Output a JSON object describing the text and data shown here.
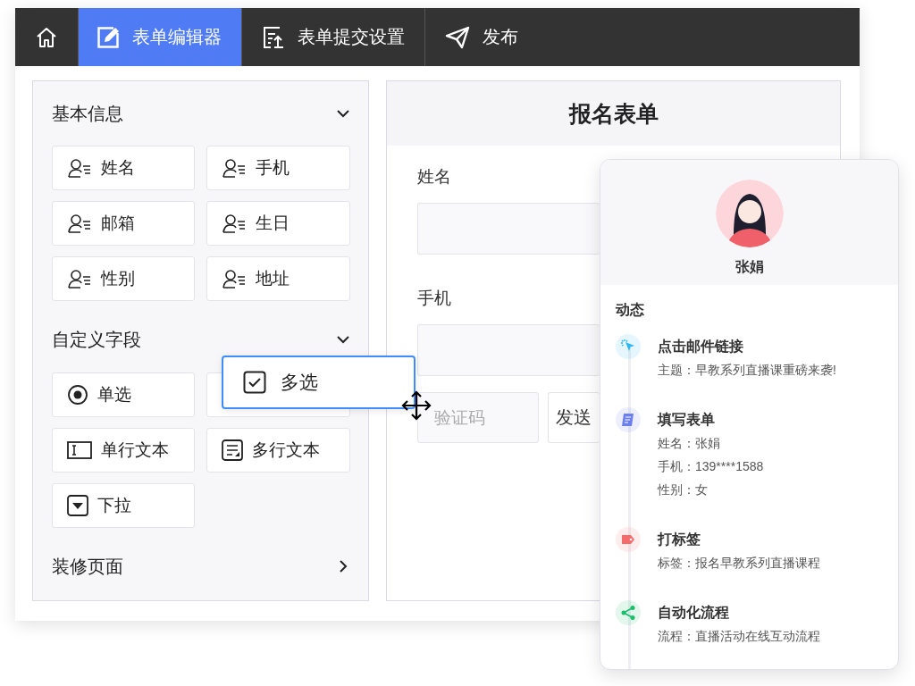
{
  "nav": {
    "tabs": [
      {
        "kind": "home",
        "selected": false
      },
      {
        "kind": "editor",
        "label": "表单编辑器",
        "selected": true
      },
      {
        "kind": "submit",
        "label": "表单提交设置",
        "selected": false
      },
      {
        "kind": "publish",
        "label": "发布",
        "selected": false
      }
    ]
  },
  "palette": {
    "sections": [
      {
        "title": "基本信息",
        "expanded": true,
        "fields": [
          {
            "kind": "person",
            "label": "姓名"
          },
          {
            "kind": "person",
            "label": "手机"
          },
          {
            "kind": "person",
            "label": "邮箱"
          },
          {
            "kind": "person",
            "label": "生日"
          },
          {
            "kind": "person",
            "label": "性别"
          },
          {
            "kind": "person",
            "label": "地址"
          }
        ]
      },
      {
        "title": "自定义字段",
        "expanded": true,
        "fields": [
          {
            "kind": "radio",
            "label": "单选"
          },
          {
            "kind": "empty"
          },
          {
            "kind": "single-line",
            "label": "单行文本"
          },
          {
            "kind": "multi-line",
            "label": "多行文本"
          },
          {
            "kind": "dropdown",
            "label": "下拉"
          }
        ]
      },
      {
        "title": "装修页面",
        "expanded": false
      }
    ]
  },
  "dragging": {
    "kind": "checkbox",
    "label": "多选"
  },
  "form": {
    "title": "报名表单",
    "fields": [
      {
        "kind": "text",
        "label": "姓名"
      },
      {
        "kind": "text",
        "label": "手机"
      },
      {
        "kind": "code",
        "placeholder": "验证码",
        "button": "发送"
      }
    ]
  },
  "contact_card": {
    "name": "张娟",
    "activity_title": "动态",
    "events": [
      {
        "kind": "click",
        "color": "#2db7f5",
        "title": "点击邮件链接",
        "details": [
          "主题：早教系列直播课重磅来袭!"
        ]
      },
      {
        "kind": "form",
        "color": "#6b7ff0",
        "title": "填写表单",
        "details": [
          "姓名：张娟",
          "手机：139****1588",
          "性别：女"
        ]
      },
      {
        "kind": "tag",
        "color": "#f56c6c",
        "title": "打标签",
        "details": [
          "标签：报名早教系列直播课程"
        ]
      },
      {
        "kind": "flow",
        "color": "#19be6b",
        "title": "自动化流程",
        "details": [
          "流程：直播活动在线互动流程"
        ]
      }
    ]
  }
}
